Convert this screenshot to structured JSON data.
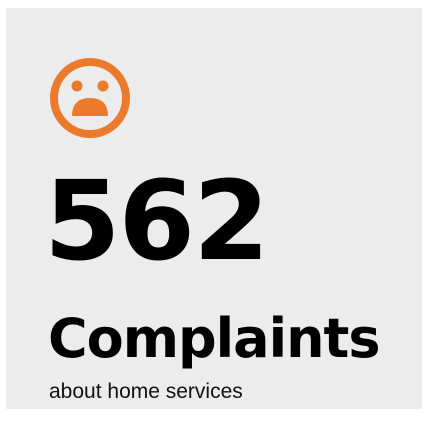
{
  "stat": {
    "icon": "sad-face-icon",
    "accent_color": "#ec7a2c",
    "value": "562",
    "label": "Complaints",
    "sublabel": "about home services"
  }
}
